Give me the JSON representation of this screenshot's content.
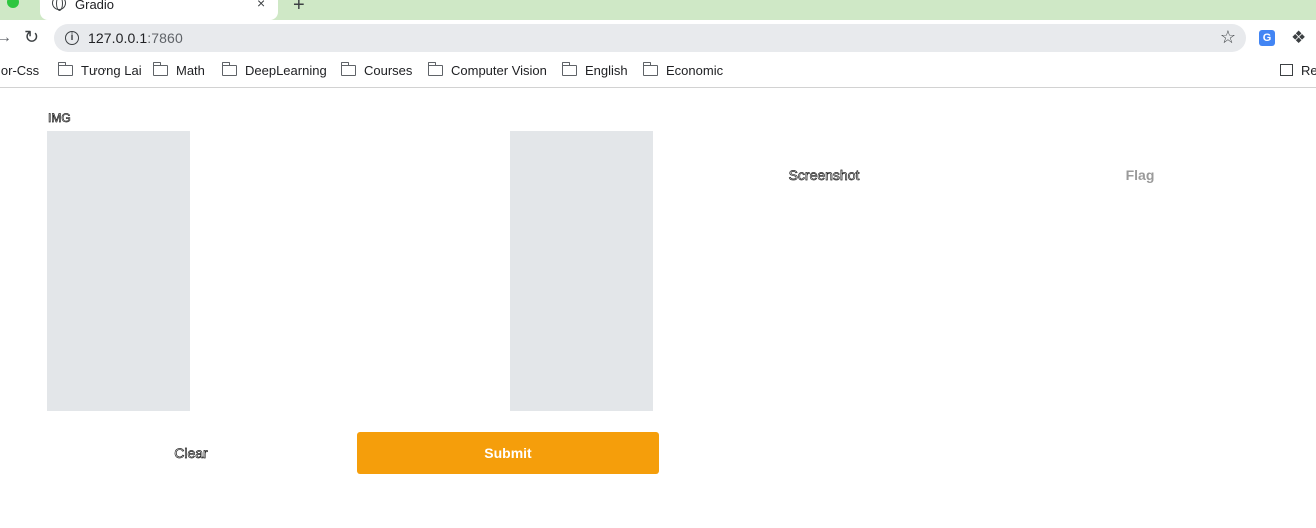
{
  "browser": {
    "tab": {
      "title": "Gradio",
      "close_glyph": "×"
    },
    "new_tab_glyph": "+",
    "address": {
      "host": "127.0.0.1",
      "port": ":7860"
    },
    "bookmarks": [
      {
        "label": "lor-Css",
        "folder": false
      },
      {
        "label": "Tương Lai",
        "folder": true
      },
      {
        "label": "Math",
        "folder": true
      },
      {
        "label": "DeepLearning",
        "folder": true
      },
      {
        "label": "Courses",
        "folder": true
      },
      {
        "label": "Computer Vision",
        "folder": true
      },
      {
        "label": "English",
        "folder": true
      },
      {
        "label": "Economic",
        "folder": true
      }
    ],
    "reading_list_label": "Re",
    "icons": {
      "back": "back-arrow-icon",
      "reload": "reload-icon",
      "info": "info-icon",
      "star": "star-icon",
      "translate": "google-translate-icon",
      "extensions": "puzzle-icon"
    }
  },
  "app": {
    "input_label": "IMG",
    "buttons": {
      "screenshot": "Screenshot",
      "flag": "Flag",
      "clear": "Clear",
      "submit": "Submit"
    },
    "colors": {
      "submit_bg": "#f59e0b",
      "image_placeholder": "#e3e6e9",
      "tabstrip": "#cfe8c6"
    }
  }
}
